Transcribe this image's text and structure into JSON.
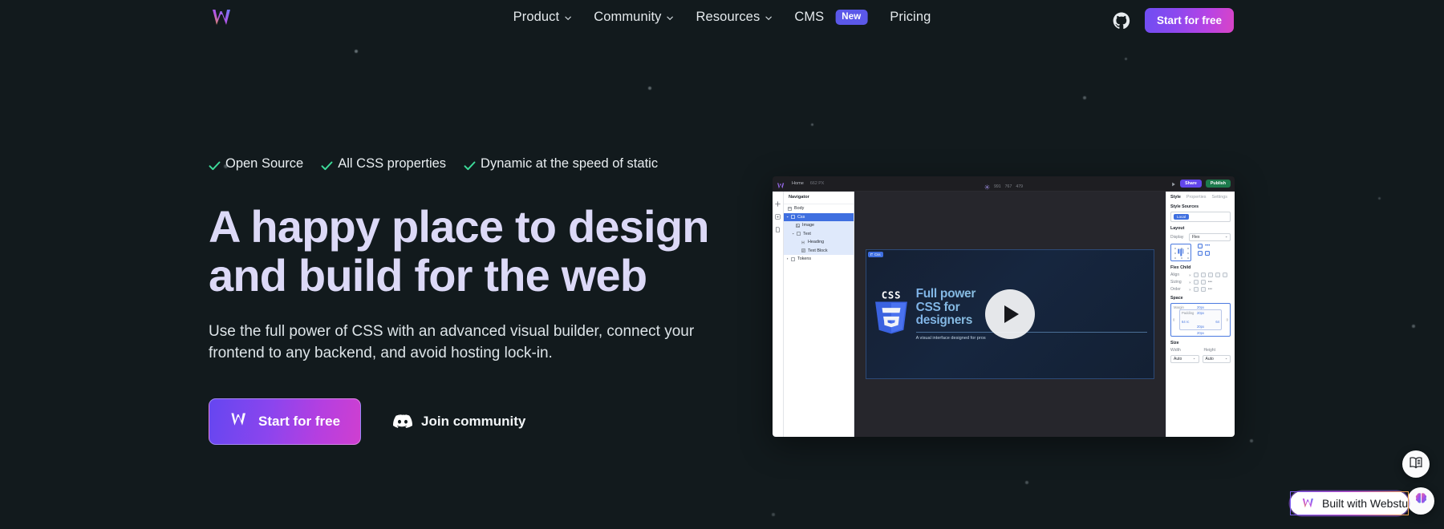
{
  "theme": {
    "bg": "#121a1d",
    "accent_gradient_from": "#6f4ef2",
    "accent_gradient_to": "#d944c6",
    "check_color": "#3ddc9a",
    "badge_color": "#5b58e8",
    "heading_color": "#dcd9f7"
  },
  "nav": {
    "logo_name": "webstudio-logo",
    "items": [
      {
        "label": "Product",
        "has_chevron": true
      },
      {
        "label": "Community",
        "has_chevron": true
      },
      {
        "label": "Resources",
        "has_chevron": true
      },
      {
        "label": "CMS",
        "has_chevron": false,
        "badge": "New"
      },
      {
        "label": "Pricing",
        "has_chevron": false
      }
    ],
    "github_icon": "github-icon",
    "cta_label": "Start for free"
  },
  "hero": {
    "features": [
      {
        "icon": "check-icon",
        "label": "Open Source"
      },
      {
        "icon": "check-icon",
        "label": "All CSS properties"
      },
      {
        "icon": "check-icon",
        "label": "Dynamic at the speed of static"
      }
    ],
    "title_line1": "A happy place to design",
    "title_line2": "and build for the web",
    "subtitle": "Use the full power of CSS with an advanced visual builder, connect your frontend to any backend, and avoid hosting lock-in.",
    "cta_primary": "Start for free",
    "cta_secondary": "Join community",
    "cta_secondary_icon": "discord-icon"
  },
  "mockup": {
    "topbar": {
      "logo": "webstudio-logo",
      "project": "Home",
      "dimensions": "662 PX",
      "breakpoints": [
        "991",
        "767",
        "479"
      ],
      "share_label": "Share",
      "publish_label": "Publish"
    },
    "navigator": {
      "title": "Navigator",
      "tree": [
        {
          "label": "Body",
          "depth": 0,
          "state": "normal",
          "icon": "body-icon"
        },
        {
          "label": "Css",
          "depth": 0,
          "state": "selected",
          "icon": "box-icon"
        },
        {
          "label": "Image",
          "depth": 1,
          "state": "highlight",
          "icon": "image-icon"
        },
        {
          "label": "Text",
          "depth": 1,
          "state": "highlight",
          "icon": "box-icon"
        },
        {
          "label": "Heading",
          "depth": 2,
          "state": "highlight",
          "icon": "heading-icon"
        },
        {
          "label": "Text Block",
          "depth": 2,
          "state": "highlight",
          "icon": "textblock-icon"
        },
        {
          "label": "Tokens",
          "depth": 0,
          "state": "normal",
          "icon": "box-icon"
        }
      ]
    },
    "canvas": {
      "selection_tag": "Css",
      "video_title_line1": "Full power",
      "video_title_line2": "CSS for",
      "video_title_line3": "designers",
      "video_subtitle": "A visual interface designed for pros",
      "logo_text": "CSS",
      "play_button": "play-button"
    },
    "inspector": {
      "tabs": [
        "Style",
        "Properties",
        "Settings"
      ],
      "active_tab": "Style",
      "style_sources_title": "Style Sources",
      "style_source_chip": "Local",
      "layout_title": "Layout",
      "display_label": "Display",
      "display_value": "Flex",
      "flex_child_title": "Flex Child",
      "align_label": "Align",
      "sizing_label": "Sizing",
      "order_label": "Order",
      "space_title": "Space",
      "margin_label": "Margin",
      "padding_label": "Padding",
      "space_values": [
        "20px",
        "20px",
        "20px",
        "20px",
        "64 rc"
      ],
      "size_title": "Size",
      "width_label": "Width",
      "height_label": "Height",
      "width_value": "Auto",
      "height_value": "Auto"
    }
  },
  "widgets": {
    "docs_icon": "book-icon",
    "ai_icon": "brain-icon",
    "built_badge": "Built with Webstu",
    "built_logo": "webstudio-logo"
  }
}
